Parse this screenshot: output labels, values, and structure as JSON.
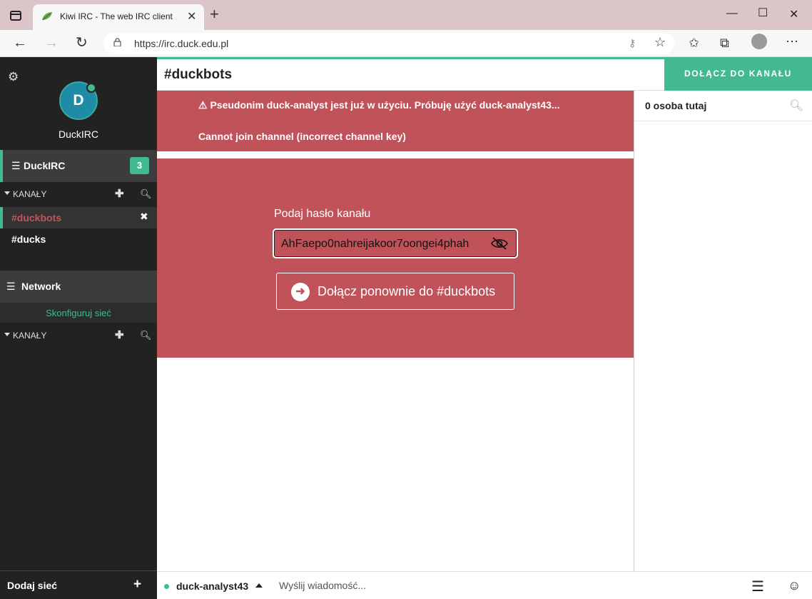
{
  "browser": {
    "tab_title": "Kiwi IRC - The web IRC client",
    "url": "https://irc.duck.edu.pl",
    "icons": [
      "tab-switch-icon",
      "favicon",
      "close-icon",
      "plus-icon",
      "minimize-icon",
      "maximize-icon",
      "close-window-icon",
      "back-icon",
      "forward-icon",
      "refresh-icon",
      "lock-icon",
      "key-icon",
      "star-add-icon",
      "favorites-icon",
      "collections-icon",
      "profile-icon",
      "more-icon"
    ]
  },
  "sidebar": {
    "user_initial": "D",
    "user_name": "DuckIRC",
    "networks": [
      {
        "name": "DuckIRC",
        "badge": "3",
        "section_label": "KANAŁY",
        "channels": [
          {
            "name": "#duckbots",
            "active": true
          },
          {
            "name": "#ducks",
            "active": false
          }
        ]
      },
      {
        "name": "Network",
        "config_label": "Skonfiguruj sieć",
        "section_label": "KANAŁY"
      }
    ],
    "add_network_label": "Dodaj sieć"
  },
  "channel": {
    "title": "#duckbots",
    "join_button": "DOŁĄCZ DO KANAŁU"
  },
  "messages": {
    "alert_lines": [
      "⚠ Pseudonim duck-analyst jest już w użyciu. Próbuję użyć duck-analyst43...",
      "Cannot join channel (incorrect channel key)"
    ],
    "key_label": "Podaj hasło kanału",
    "key_value": "AhFaepo0nahreijakoor7oongei4phah",
    "rejoin_button": "Dołącz ponownie do #duckbots"
  },
  "userlist": {
    "count_label": "0 osoba tutaj"
  },
  "bottom": {
    "nick": "duck-analyst43",
    "message_placeholder": "Wyślij wiadomość..."
  },
  "colors": {
    "accent": "#42b992",
    "alert": "#c0525a",
    "sidebar": "#222222"
  }
}
